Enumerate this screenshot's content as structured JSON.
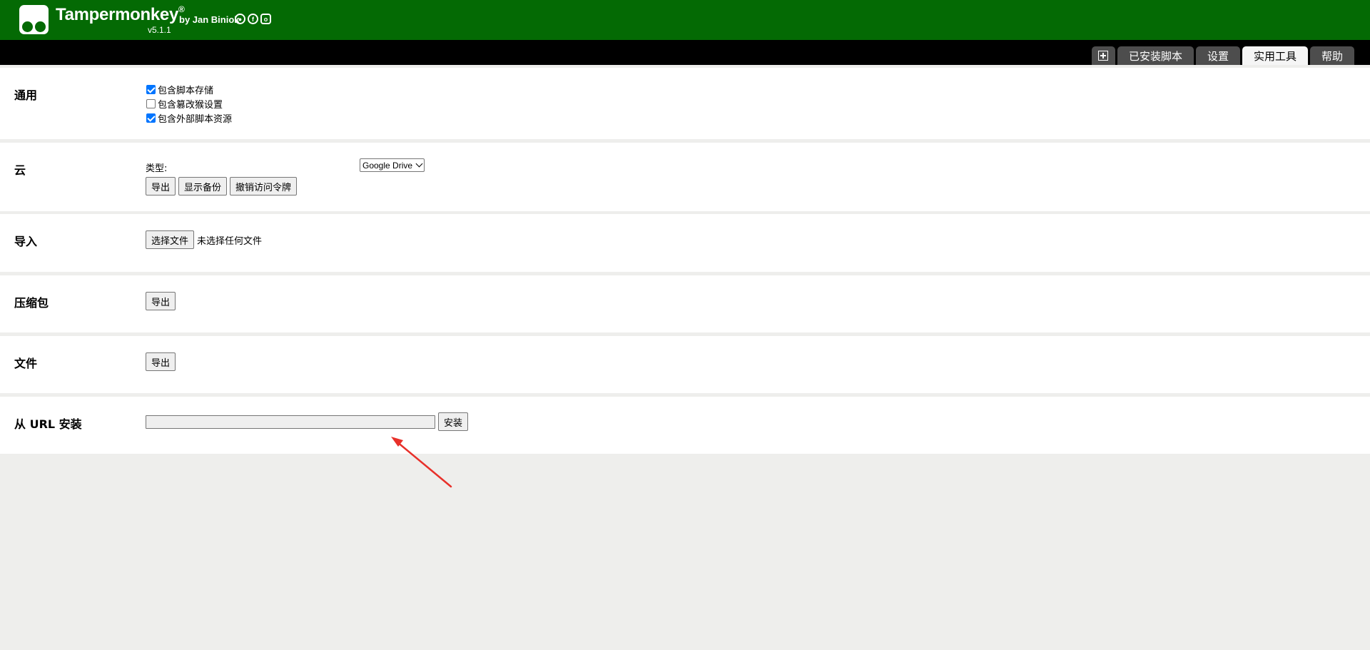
{
  "header": {
    "app_name": "Tampermonkey",
    "registered_mark": "®",
    "byline": "by Jan Biniok",
    "version": "v5.1.1",
    "social_icons": [
      "github-icon",
      "facebook-icon",
      "instagram-icon"
    ],
    "brand_color": "#046a04"
  },
  "tabs": [
    {
      "label": "",
      "icon": "plus-box-icon"
    },
    {
      "label": "已安装脚本"
    },
    {
      "label": "设置"
    },
    {
      "label": "实用工具",
      "active": true
    },
    {
      "label": "帮助"
    }
  ],
  "sections": {
    "general": {
      "title": "通用",
      "options": [
        {
          "label": "包含脚本存储",
          "checked": true
        },
        {
          "label": "包含篡改猴设置",
          "checked": false
        },
        {
          "label": "包含外部脚本资源",
          "checked": true
        }
      ]
    },
    "cloud": {
      "title": "云",
      "type_label": "类型:",
      "type_value": "Google Drive",
      "buttons": [
        "导出",
        "显示备份",
        "撤销访问令牌"
      ]
    },
    "import": {
      "title": "导入",
      "choose_file": "选择文件",
      "no_file": "未选择任何文件"
    },
    "zip": {
      "title": "压缩包",
      "export": "导出"
    },
    "file": {
      "title": "文件",
      "export": "导出"
    },
    "url_install": {
      "title": "从 URL 安装",
      "input_value": "",
      "install": "安装"
    }
  },
  "annotation": {
    "color": "#e8302a"
  }
}
